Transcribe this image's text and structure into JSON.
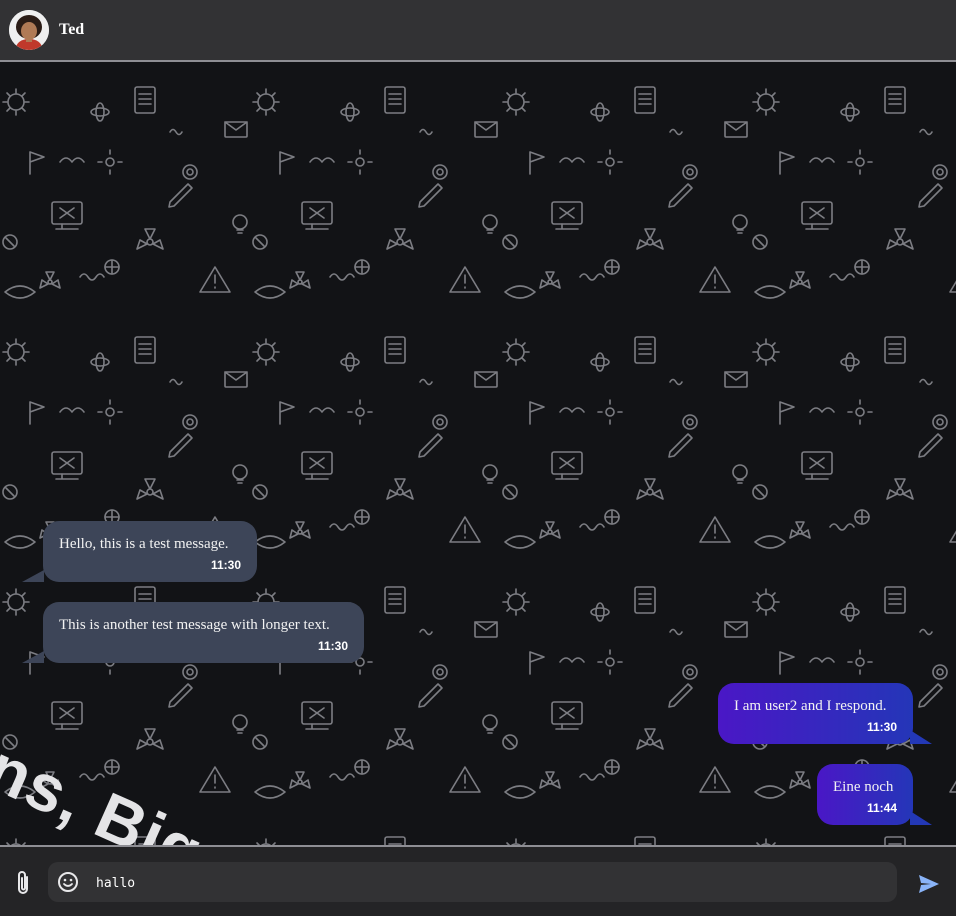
{
  "header": {
    "contact_name": "Ted"
  },
  "chat": {
    "watermark_text": "ons, Bigger T",
    "messages": [
      {
        "direction": "incoming",
        "text": "Hello, this is a test message.",
        "time": "11:30"
      },
      {
        "direction": "incoming",
        "text": "This is another test message with longer text.",
        "time": "11:30"
      },
      {
        "direction": "outgoing",
        "text": "I am user2 and I respond.",
        "time": "11:30"
      },
      {
        "direction": "outgoing",
        "text": "Eine noch",
        "time": "11:44"
      }
    ]
  },
  "composer": {
    "value": "hallo",
    "attach_icon": "paperclip-icon",
    "emoji_icon": "smiley-icon",
    "send_icon": "send-icon"
  },
  "colors": {
    "header_bg": "#323234",
    "chat_bg": "#121316",
    "incoming_bubble": "#3d4558",
    "outgoing_bubble_start": "#4a17c6",
    "outgoing_bubble_end": "#2436b8",
    "send_icon": "#8ab4f8"
  }
}
